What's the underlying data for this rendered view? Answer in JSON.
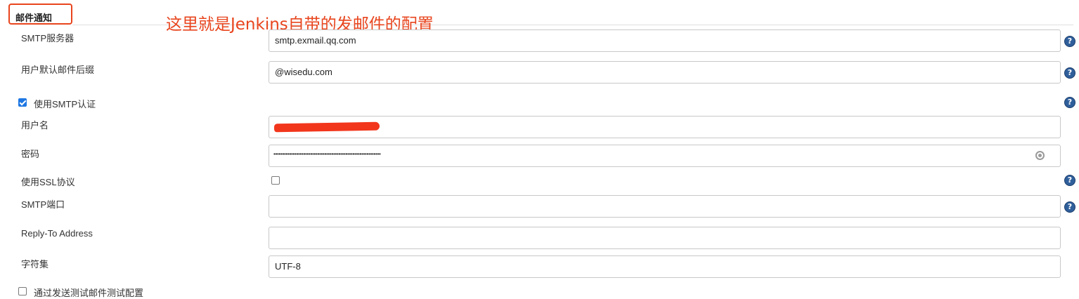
{
  "section": {
    "title": "邮件通知"
  },
  "annotation": "这里就是Jenkins自带的发邮件的配置",
  "fields": {
    "smtp_server": {
      "label": "SMTP服务器",
      "value": "smtp.exmail.qq.com"
    },
    "default_suffix": {
      "label": "用户默认邮件后缀",
      "value": "@wisedu.com"
    },
    "use_smtp_auth": {
      "label": "使用SMTP认证",
      "checked": true
    },
    "username": {
      "label": "用户名",
      "value": ""
    },
    "password": {
      "label": "密码",
      "value": "•••••••••••••••••••••••••••••••••••••••••••••••••••••••••••••"
    },
    "use_ssl": {
      "label": "使用SSL协议",
      "checked": false
    },
    "smtp_port": {
      "label": "SMTP端口",
      "value": ""
    },
    "reply_to": {
      "label": "Reply-To Address",
      "value": ""
    },
    "charset": {
      "label": "字符集",
      "value": "UTF-8"
    },
    "test_config": {
      "label": "通过发送测试邮件测试配置",
      "checked": false
    }
  },
  "icons": {
    "help": "help-question-icon",
    "password_reveal": "password-key-icon"
  },
  "colors": {
    "annotation": "#e8451e",
    "help_icon": "#2f5f9b",
    "checkbox_checked": "#1e77e3",
    "redaction": "#f2361c"
  },
  "help_glyph": "?"
}
